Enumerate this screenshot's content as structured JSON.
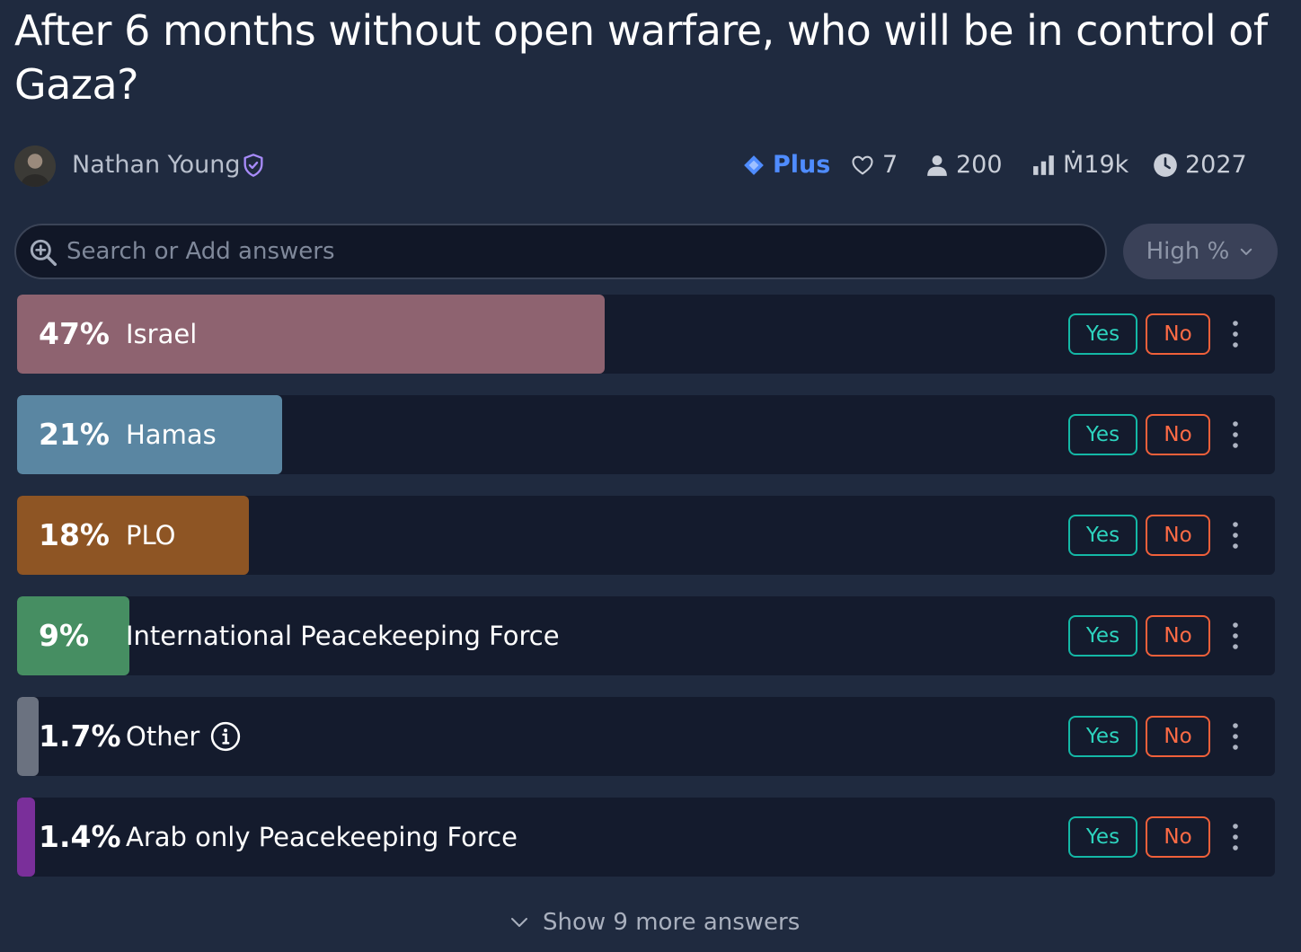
{
  "question": {
    "title": "After 6 months without open warfare, who will be in control of Gaza?"
  },
  "creator": {
    "name": "Nathan Young"
  },
  "stats": {
    "tier": "Plus",
    "likes": "7",
    "traders": "200",
    "volume": "Ṁ19k",
    "close_year": "2027"
  },
  "search": {
    "placeholder": "Search or Add answers"
  },
  "sort": {
    "label": "High %"
  },
  "answers": [
    {
      "percent_label": "47%",
      "fraction": 0.467,
      "label": "Israel",
      "color": "#8e6370"
    },
    {
      "percent_label": "21%",
      "fraction": 0.211,
      "label": "Hamas",
      "color": "#5a86a2"
    },
    {
      "percent_label": "18%",
      "fraction": 0.184,
      "label": "PLO",
      "color": "#8e5524"
    },
    {
      "percent_label": "9%",
      "fraction": 0.089,
      "label": "International Peacekeeping Force",
      "color": "#468e62"
    },
    {
      "percent_label": "1.7%",
      "fraction": 0.017,
      "label": "Other",
      "color": "#6b7280"
    },
    {
      "percent_label": "1.4%",
      "fraction": 0.014,
      "label": "Arab only Peacekeeping Force",
      "color": "#7a2f9a"
    }
  ],
  "buttons": {
    "yes": "Yes",
    "no": "No"
  },
  "footer": {
    "show_more": "Show 9 more answers"
  },
  "colors": {
    "accent": "#4f8cff",
    "yes": "#14b8a6",
    "no": "#f0603a",
    "verified": "#a78bfa"
  }
}
